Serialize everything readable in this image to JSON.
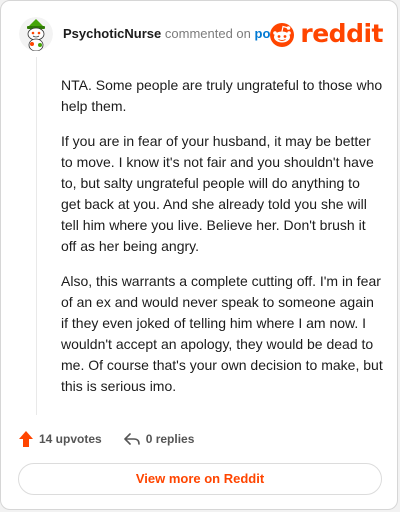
{
  "comment": {
    "author": "PsychoticNurse",
    "action_text": "commented on",
    "post_link_text": "post",
    "paragraphs": [
      "NTA. Some people are truly ungrateful to those who help them.",
      "If you are in fear of your husband, it may be better to move. I know it's not fair and you shouldn't have to, but salty ungrateful people will do anything to get back at you. And she already told you she will tell him where you live. Believe her. Don't brush it off as her being angry.",
      "Also, this warrants a complete cutting off. I'm in fear of an ex and would never speak to someone again if they even joked of telling him where I am now. I wouldn't accept an apology, they would be dead to me. Of course that's your own decision to make, but this is serious imo."
    ],
    "upvotes_label": "14 upvotes",
    "replies_label": "0 replies"
  },
  "brand": {
    "name": "reddit",
    "color": "#ff4500",
    "logo_icon": "reddit-snoo-icon"
  },
  "footer": {
    "view_button_label": "View more on Reddit"
  },
  "icons": {
    "upvote": "upvote-arrow-icon",
    "reply": "reply-arrow-icon",
    "avatar": "snoo-avatar"
  },
  "colors": {
    "accent": "#ff4500",
    "link": "#0079d3",
    "text": "#1c1c1c",
    "muted": "#7c7c7c"
  }
}
